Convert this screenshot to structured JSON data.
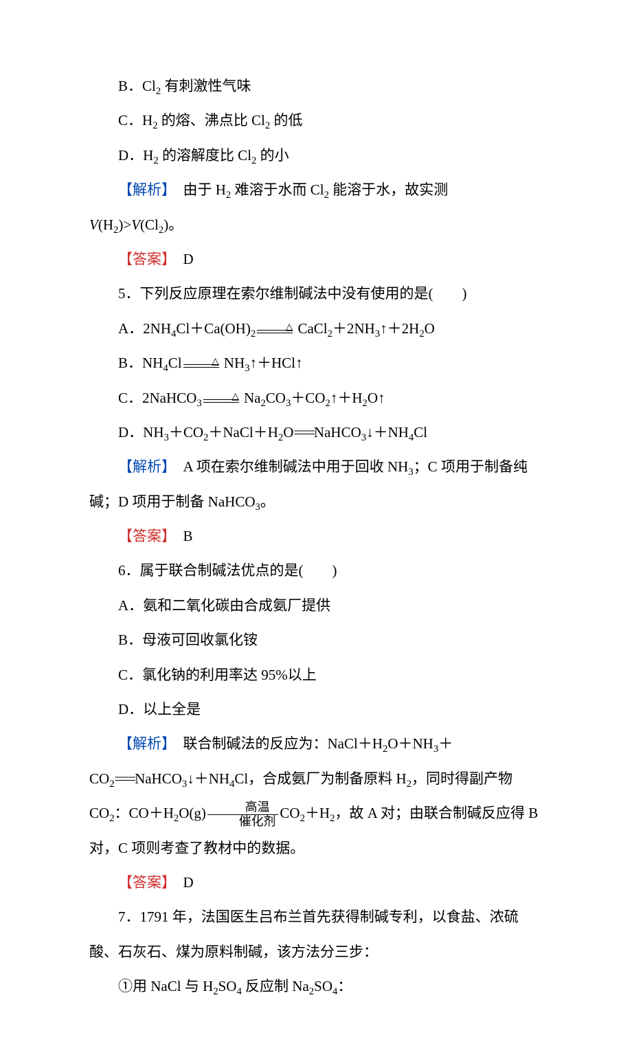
{
  "options_first": {
    "B": "B．Cl₂ 有刺激性气味",
    "C": "C．H₂ 的熔、沸点比 Cl₂ 的低",
    "D": "D．H₂ 的溶解度比 Cl₂ 的小"
  },
  "analysis1_label": "【解析】",
  "analysis1_text": "　由于 H₂ 难溶于水而 Cl₂ 能溶于水，故实测 ",
  "analysis1_formula_prefix": "V",
  "analysis1_formula_mid": "(H₂)>",
  "analysis1_formula_suffix": "V",
  "analysis1_formula_end": "(Cl₂)。",
  "answer_label": "【答案】",
  "answer1": "　D",
  "q5": {
    "stem": "5．下列反应原理在索尔维制碱法中没有使用的是(　　)",
    "opts": {
      "A": "A．2NH₄Cl＋Ca(OH)₂",
      "A_rhs": " CaCl₂＋2NH₃↑＋2H₂O",
      "B": "B．NH₄Cl",
      "B_rhs": " NH₃↑＋HCl↑",
      "C": "C．2NaHCO₃",
      "C_rhs": " Na₂CO₃＋CO₂↑＋H₂O↑",
      "D": "D．NH₃＋CO₂＋NaCl＋H₂O",
      "D_rhs": "NaHCO₃↓＋NH₄Cl"
    },
    "analysis": "　A 项在索尔维制碱法中用于回收 NH₃；C 项用于制备纯碱；D 项用于制备 NaHCO₃。",
    "answer": "　B"
  },
  "q6": {
    "stem": "6．属于联合制碱法优点的是(　　)",
    "opts": {
      "A": "A．氨和二氧化碳由合成氨厂提供",
      "B": "B．母液可回收氯化铵",
      "C": "C．氯化钠的利用率达 95%以上",
      "D": "D．以上全是"
    },
    "analysis_p1_pre": "　联合制碱法的反应为：NaCl＋H₂O＋NH₃＋CO₂",
    "analysis_p1_post": "NaHCO₃↓＋NH₄Cl，合成氨厂为制备原料 H₂，同时得副产物 CO₂：CO＋H₂O(g)",
    "analysis_p1_tail": "CO₂＋H₂，故 A 对；由联合制碱反应得 B 对，C 项则考查了教材中的数据。",
    "cond_top": "高温",
    "cond_bot": "催化剂",
    "answer": "　D"
  },
  "q7": {
    "stem": "7．1791 年，法国医生吕布兰首先获得制碱专利，以食盐、浓硫酸、石灰石、煤为原料制碱，该方法分三步：",
    "step1": "①用 NaCl 与 H₂SO₄ 反应制 Na₂SO₄："
  }
}
